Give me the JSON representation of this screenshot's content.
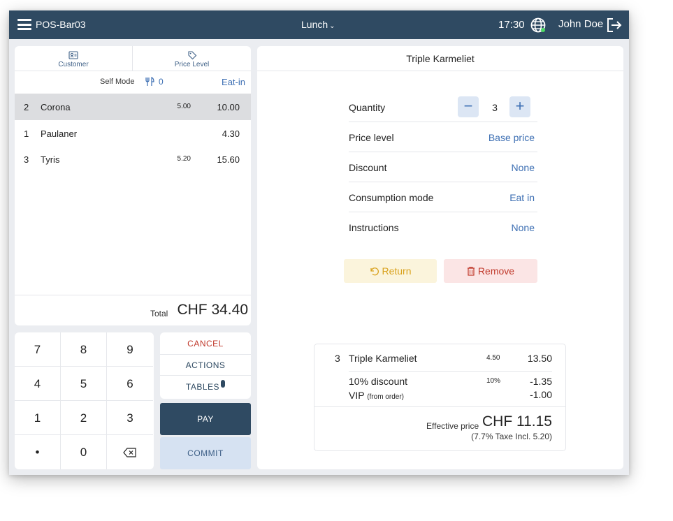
{
  "topbar": {
    "device": "POS-Bar03",
    "service": "Lunch",
    "time": "17:30",
    "user": "John Doe",
    "bg_color": "#2f4a62"
  },
  "tabs": {
    "customer": "Customer",
    "price_level": "Price Level"
  },
  "mode": {
    "self_mode": "Self Mode",
    "guests": "0",
    "consumption": "Eat-in"
  },
  "order_lines": [
    {
      "qty": "2",
      "name": "Corona",
      "unit": "5.00",
      "total": "10.00",
      "selected": true
    },
    {
      "qty": "1",
      "name": "Paulaner",
      "unit": "",
      "total": "4.30",
      "selected": false
    },
    {
      "qty": "3",
      "name": "Tyris",
      "unit": "5.20",
      "total": "15.60",
      "selected": false
    }
  ],
  "total": {
    "label": "Total",
    "value": "CHF 34.40"
  },
  "keypad": {
    "keys": [
      "7",
      "8",
      "9",
      "4",
      "5",
      "6",
      "1",
      "2",
      "3",
      "•",
      "0"
    ]
  },
  "actions": {
    "cancel": "CANCEL",
    "actions": "ACTIONS",
    "tables": "TABLES",
    "pay": "PAY",
    "commit": "COMMIT"
  },
  "detail": {
    "title": "Triple Karmeliet",
    "quantity_label": "Quantity",
    "quantity_value": "3",
    "minus": "−",
    "plus": "+",
    "price_level_label": "Price level",
    "price_level_value": "Base price",
    "discount_label": "Discount",
    "discount_value": "None",
    "consumption_label": "Consumption mode",
    "consumption_value": "Eat in",
    "instructions_label": "Instructions",
    "instructions_value": "None",
    "return_label": "Return",
    "remove_label": "Remove"
  },
  "summary": {
    "qty": "3",
    "name": "Triple Karmeliet",
    "unit": "4.50",
    "total": "13.50",
    "discount_label": "10% discount",
    "discount_pct": "10%",
    "discount_value": "-1.35",
    "vip_label": "VIP",
    "vip_note": "(from order)",
    "vip_value": "-1.00",
    "effective_label": "Effective price",
    "effective_value": "CHF 11.15",
    "tax_note": "(7.7% Taxe Incl. 5.20)"
  }
}
